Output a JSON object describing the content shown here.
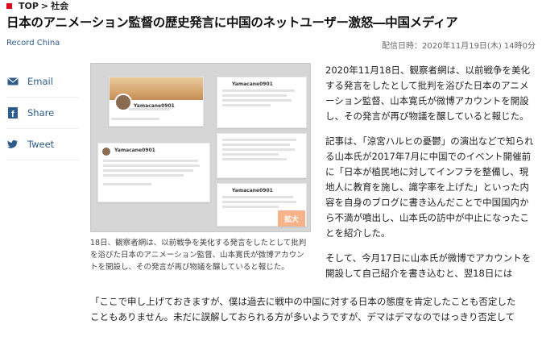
{
  "breadcrumb": {
    "top": "TOP",
    "separator": ">",
    "section": "社会"
  },
  "headline": "日本のアニメーション監督の歴史発言に中国のネットユーザー激怒―中国メディア",
  "source": "Record China",
  "date": "配信日時：2020年11月19日(木) 14時0分",
  "share": {
    "email": "Email",
    "share": "Share",
    "tweet": "Tweet"
  },
  "photo": {
    "enlarge_label": "拡大",
    "profile_name": "Yamacane0901",
    "card_name_1": "Yamacane0901",
    "card_name_2": "Yamacane0901",
    "card_name_3": "Yamacane0901"
  },
  "caption": "18日、観察者網は、以前戦争を美化する発言をしたとして批判を浴びた日本のアニメーション監督、山本寛氏が微博アカウントを開設し、その発言が再び物議を醸していると報じた。",
  "body": {
    "p1": "2020年11月18日、観察者網は、以前戦争を美化する発言をしたとして批判を浴びた日本のアニメーション監督、山本寛氏が微博アカウントを開設し、その発言が再び物議を醸していると報じた。",
    "p2": "記事は、「涼宮ハルヒの憂鬱」の演出などで知られる山本氏が2017年7月に中国でのイベント開催前に「日本が植民地に対してインフラを整備し、現地人に教育を施し、識字率を上げた」といった内容を自身のブログに書き込んだことで中国国内から不満が噴出し、山本氏の訪中が中止になったことを紹介した。",
    "p3": "そして、今月17日に山本氏が微博でアカウントを開設して自己紹介を書き込むと、翌18日には"
  },
  "bottom": {
    "line1": "「ここで申し上げておきますが、僕は過去に戦中の中国に対する日本の態度を肯定したことも否定した",
    "line2": "こともありません。未だに誤解しておられる方が多いようですが、デマはデマなのではっきり否定して"
  }
}
